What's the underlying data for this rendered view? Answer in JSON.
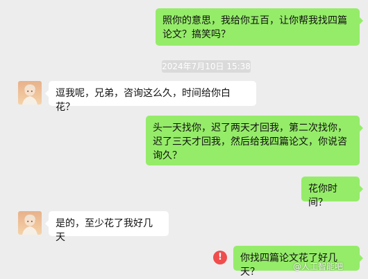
{
  "chat": {
    "timestamp": "2024年7月10日 15:38",
    "messages": [
      {
        "sender": "me",
        "text": "照你的意思，我给你五百，让你帮我找四篇论文？搞笑吗？"
      },
      {
        "sender": "other",
        "text": "逗我呢，兄弟，咨询这么久，时间给你白花？"
      },
      {
        "sender": "me",
        "text": "头一天找你，迟了两天才回我，第二次找你，迟了三天才回我，然后给我四篇论文，你说咨询久？"
      },
      {
        "sender": "me",
        "text": "花你时间？"
      },
      {
        "sender": "other",
        "text": "是的，至少花了我好几天"
      },
      {
        "sender": "me",
        "text": "你找四篇论文花了好几天？",
        "status": "failed"
      }
    ]
  },
  "icons": {
    "failed_status": "error-exclamation-icon",
    "other_avatar": "anime-boy-avatar"
  },
  "error_mark": "!",
  "watermark": "@人工智能吧",
  "colors": {
    "background": "#ededed",
    "my_bubble": "#95ec69",
    "other_bubble": "#ffffff",
    "error": "#f04d4d"
  }
}
